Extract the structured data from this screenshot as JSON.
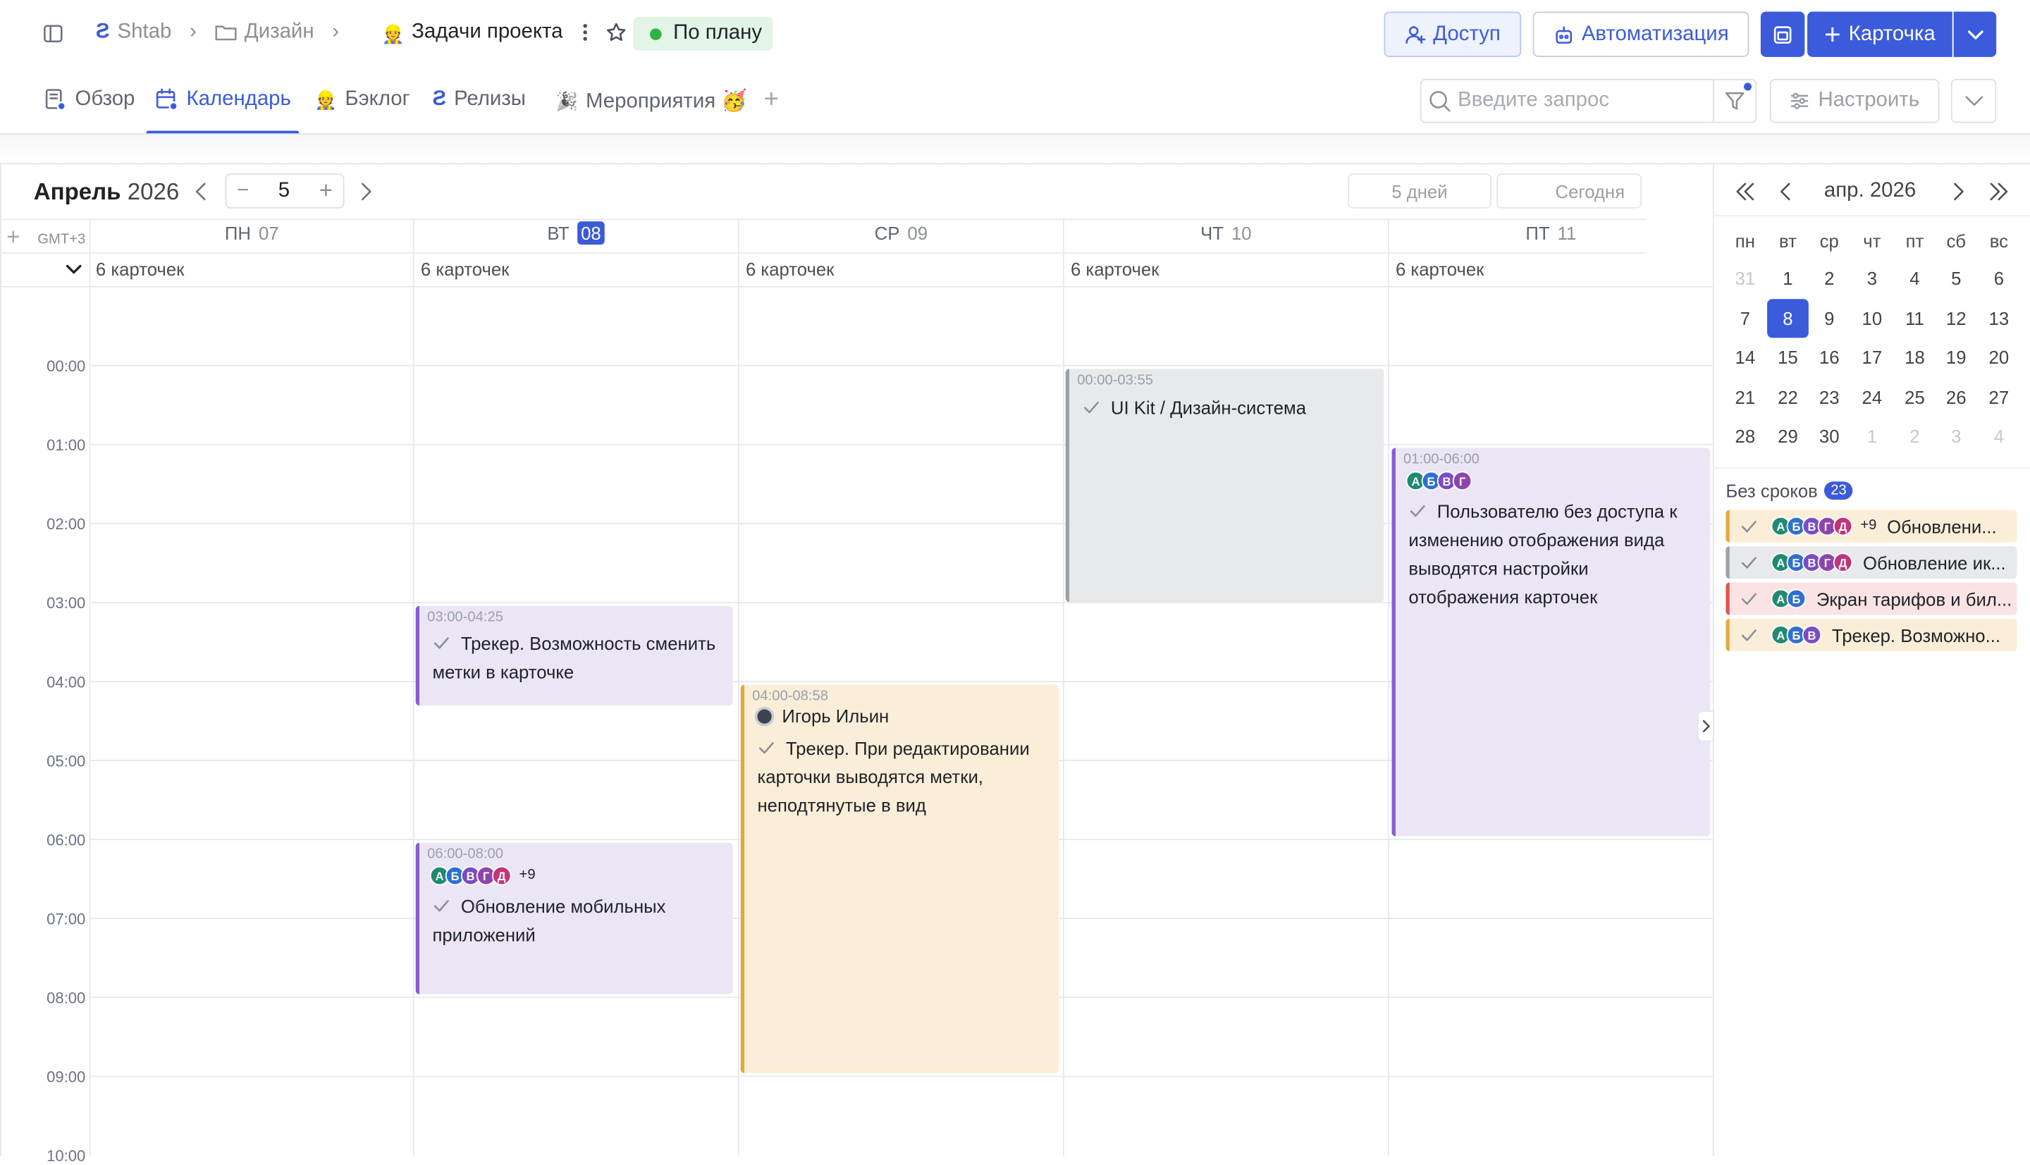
{
  "breadcrumb": {
    "workspace": "Shtab",
    "folder": "Дизайн",
    "project": "Задачи проекта",
    "status": "По плану"
  },
  "header_buttons": {
    "access": "Доступ",
    "automation": "Автоматизация",
    "card": "Карточка"
  },
  "tabs": [
    {
      "label": "Обзор",
      "icon": "overview-icon"
    },
    {
      "label": "Календарь",
      "icon": "calendar-icon"
    },
    {
      "label": "Бэклог",
      "icon": "backlog-emoji"
    },
    {
      "label": "Релизы",
      "icon": "releases-logo"
    },
    {
      "label": "Мероприятия 🥳",
      "icon": "party-icon"
    }
  ],
  "search": {
    "placeholder": "Введите запрос"
  },
  "configure_label": "Настроить",
  "calendar": {
    "month": "Апрель",
    "year": "2026",
    "range_days": "5",
    "days_button": "5 дней",
    "today_button": "Сегодня",
    "timezone": "GMT+3",
    "days": [
      {
        "dow": "ПН",
        "num": "07",
        "count": "6 карточек"
      },
      {
        "dow": "ВТ",
        "num": "08",
        "count": "6 карточек",
        "today": true
      },
      {
        "dow": "СР",
        "num": "09",
        "count": "6 карточек"
      },
      {
        "dow": "ЧТ",
        "num": "10",
        "count": "6 карточек"
      },
      {
        "dow": "ПТ",
        "num": "11",
        "count": "6 карточек"
      }
    ],
    "hours": [
      "00:00",
      "01:00",
      "02:00",
      "03:00",
      "04:00",
      "05:00",
      "06:00",
      "07:00",
      "08:00",
      "09:00",
      "10:00"
    ],
    "events": [
      {
        "time": "00:00-03:55",
        "title": "UI Kit / Дизайн-система",
        "color": "#e8e9eb",
        "border": "#9ca0a7"
      },
      {
        "time": "01:00-06:00",
        "title": "Пользователю без доступа к изменению отображения вида выводятся настройки отображения карточек",
        "avatars": [
          "А",
          "Б",
          "В",
          "Г"
        ],
        "color": "#ebe5f5",
        "border": "#8a5cd1"
      },
      {
        "time": "03:00-04:25",
        "title": "Трекер. Возможность сменить метки в карточке",
        "color": "#ebe5f5",
        "border": "#8a5cd1"
      },
      {
        "time": "04:00-08:58",
        "person": "Игорь Ильин",
        "title": "Трекер. При редактировании карточки выводятся метки, неподтянутые в вид",
        "color": "#fbeed8",
        "border": "#e2a93b"
      },
      {
        "time": "06:00-08:00",
        "avatars": [
          "А",
          "Б",
          "В",
          "Г",
          "Д"
        ],
        "more": "+9",
        "title": "Обновление мобильных приложений",
        "color": "#ebe5f5",
        "border": "#8a5cd1"
      }
    ]
  },
  "mini_calendar": {
    "title": "апр. 2026",
    "weekdays": [
      "пн",
      "вт",
      "ср",
      "чт",
      "пт",
      "сб",
      "вс"
    ],
    "weeks": [
      [
        "31",
        "1",
        "2",
        "3",
        "4",
        "5",
        "6"
      ],
      [
        "7",
        "8",
        "9",
        "10",
        "11",
        "12",
        "13"
      ],
      [
        "14",
        "15",
        "16",
        "17",
        "18",
        "19",
        "20"
      ],
      [
        "21",
        "22",
        "23",
        "24",
        "25",
        "26",
        "27"
      ],
      [
        "28",
        "29",
        "30",
        "1",
        "2",
        "3",
        "4"
      ]
    ],
    "selected": "8"
  },
  "no_deadline": {
    "label": "Без сроков",
    "count": "23",
    "items": [
      {
        "avatars": [
          "А",
          "Б",
          "В",
          "Г",
          "Д"
        ],
        "more": "+9",
        "title": "Обновлени...",
        "color": "#fbeed8",
        "border": "#e2a93b"
      },
      {
        "avatars": [
          "А",
          "Б",
          "В",
          "Г",
          "Д"
        ],
        "title": "Обновление ик...",
        "color": "#e8e9eb",
        "border": "#9ca0a7"
      },
      {
        "avatars": [
          "А",
          "Б"
        ],
        "title": "Экран тарифов и бил...",
        "color": "#fbe3e3",
        "border": "#e05252"
      },
      {
        "avatars": [
          "А",
          "Б",
          "В"
        ],
        "title": "Трекер. Возможно...",
        "color": "#fbeed8",
        "border": "#e2a93b"
      }
    ]
  },
  "avatar_colors": {
    "А": "#1f8a70",
    "Б": "#2f6fd1",
    "В": "#7a4cc2",
    "Г": "#8e44ad",
    "Д": "#c2337a"
  }
}
